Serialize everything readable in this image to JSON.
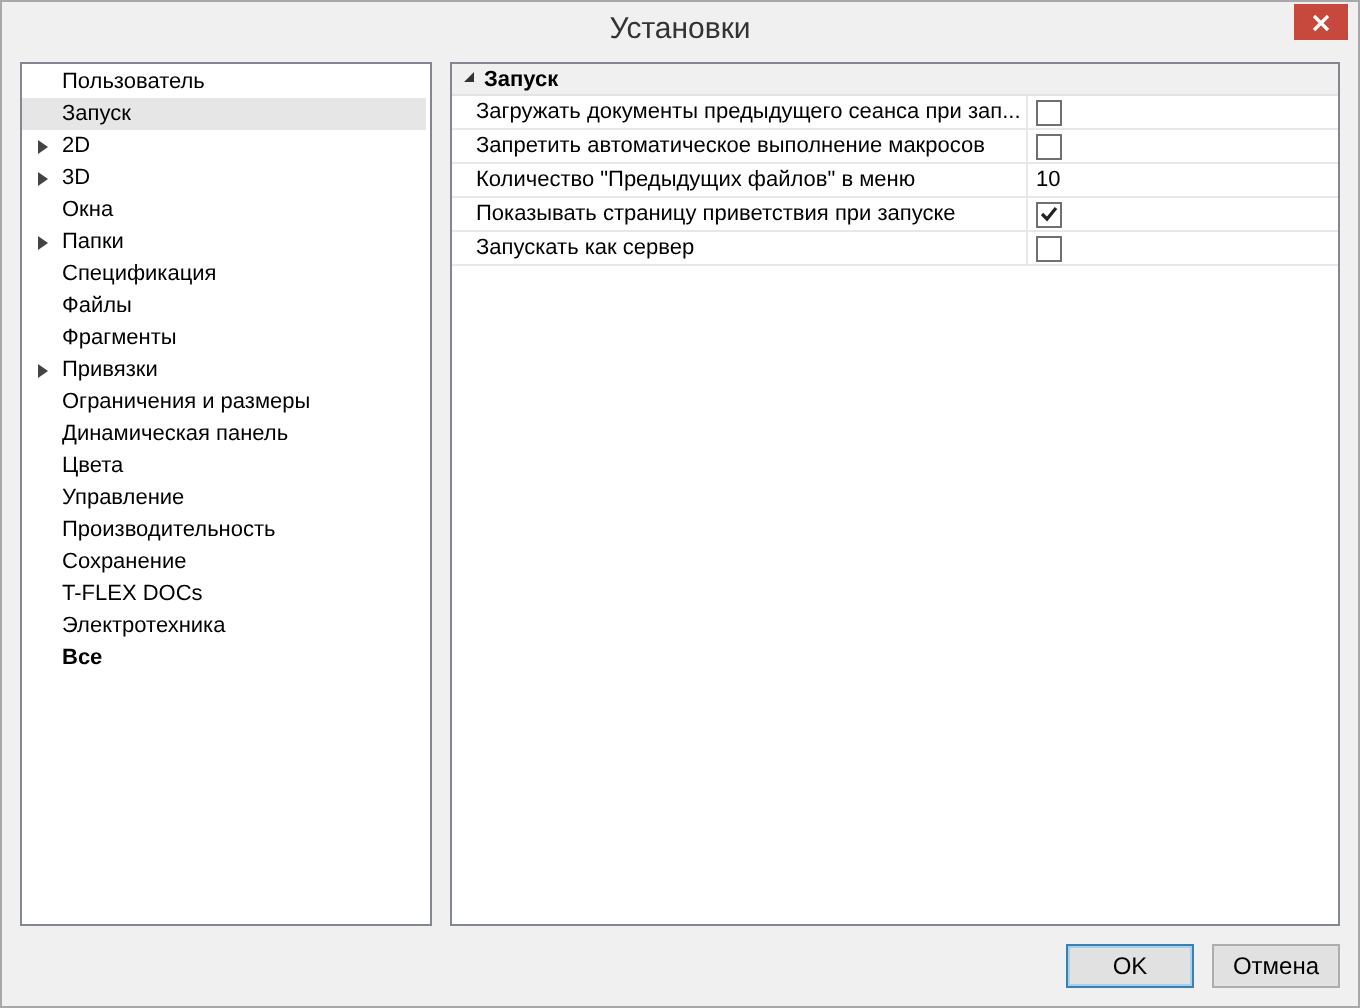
{
  "window": {
    "title": "Установки"
  },
  "tree": {
    "items": [
      {
        "label": "Пользователь",
        "expandable": false,
        "selected": false,
        "bold": false
      },
      {
        "label": "Запуск",
        "expandable": false,
        "selected": true,
        "bold": false
      },
      {
        "label": "2D",
        "expandable": true,
        "selected": false,
        "bold": false
      },
      {
        "label": "3D",
        "expandable": true,
        "selected": false,
        "bold": false
      },
      {
        "label": "Окна",
        "expandable": false,
        "selected": false,
        "bold": false
      },
      {
        "label": "Папки",
        "expandable": true,
        "selected": false,
        "bold": false
      },
      {
        "label": "Спецификация",
        "expandable": false,
        "selected": false,
        "bold": false
      },
      {
        "label": "Файлы",
        "expandable": false,
        "selected": false,
        "bold": false
      },
      {
        "label": "Фрагменты",
        "expandable": false,
        "selected": false,
        "bold": false
      },
      {
        "label": "Привязки",
        "expandable": true,
        "selected": false,
        "bold": false
      },
      {
        "label": "Ограничения и размеры",
        "expandable": false,
        "selected": false,
        "bold": false
      },
      {
        "label": "Динамическая панель",
        "expandable": false,
        "selected": false,
        "bold": false
      },
      {
        "label": "Цвета",
        "expandable": false,
        "selected": false,
        "bold": false
      },
      {
        "label": "Управление",
        "expandable": false,
        "selected": false,
        "bold": false
      },
      {
        "label": "Производительность",
        "expandable": false,
        "selected": false,
        "bold": false
      },
      {
        "label": "Сохранение",
        "expandable": false,
        "selected": false,
        "bold": false
      },
      {
        "label": "T-FLEX DOCs",
        "expandable": false,
        "selected": false,
        "bold": false
      },
      {
        "label": "Электротехника",
        "expandable": false,
        "selected": false,
        "bold": false
      },
      {
        "label": "Все",
        "expandable": false,
        "selected": false,
        "bold": true
      }
    ]
  },
  "properties": {
    "section": {
      "title": "Запуск",
      "expanded": true
    },
    "rows": [
      {
        "kind": "checkbox",
        "label": "Загружать документы предыдущего сеанса при зап...",
        "checked": false
      },
      {
        "kind": "checkbox",
        "label": "Запретить автоматическое выполнение макросов",
        "checked": false
      },
      {
        "kind": "text",
        "label": "Количество \"Предыдущих файлов\" в меню",
        "value": "10"
      },
      {
        "kind": "checkbox",
        "label": "Показывать страницу приветствия при запуске",
        "checked": true
      },
      {
        "kind": "checkbox",
        "label": "Запускать как сервер",
        "checked": false
      }
    ]
  },
  "buttons": [
    {
      "label": "OK",
      "default": true
    },
    {
      "label": "Отмена",
      "default": false
    }
  ]
}
